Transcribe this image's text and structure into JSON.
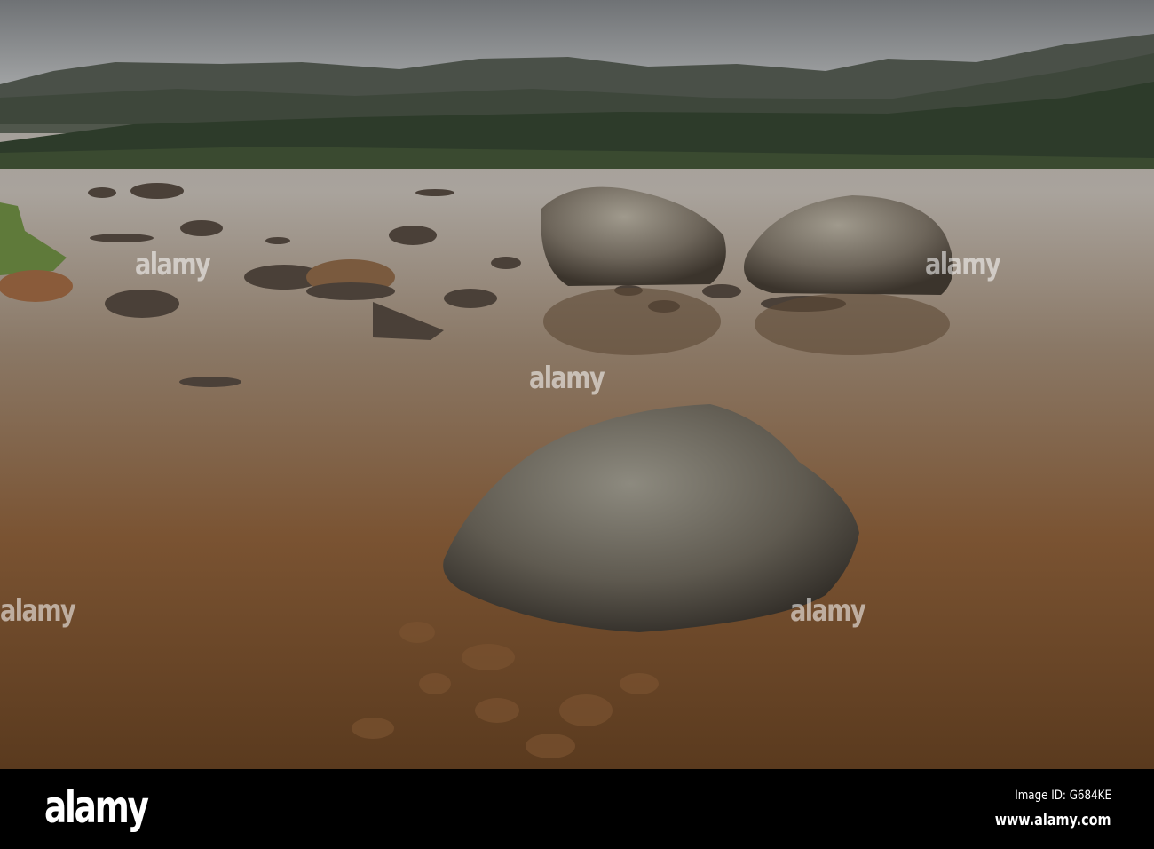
{
  "photo": {
    "subject": "Loch with boulders and mountains",
    "watermark_text": "alamy"
  },
  "footer": {
    "logo": "alamy",
    "image_id": "Image ID: G684KE",
    "website": "www.alamy.com"
  },
  "colors": {
    "sky": "#8a8d90",
    "water_top": "#a9a7a3",
    "water_bottom": "#6a4220",
    "forest": "#2d3b2a"
  }
}
